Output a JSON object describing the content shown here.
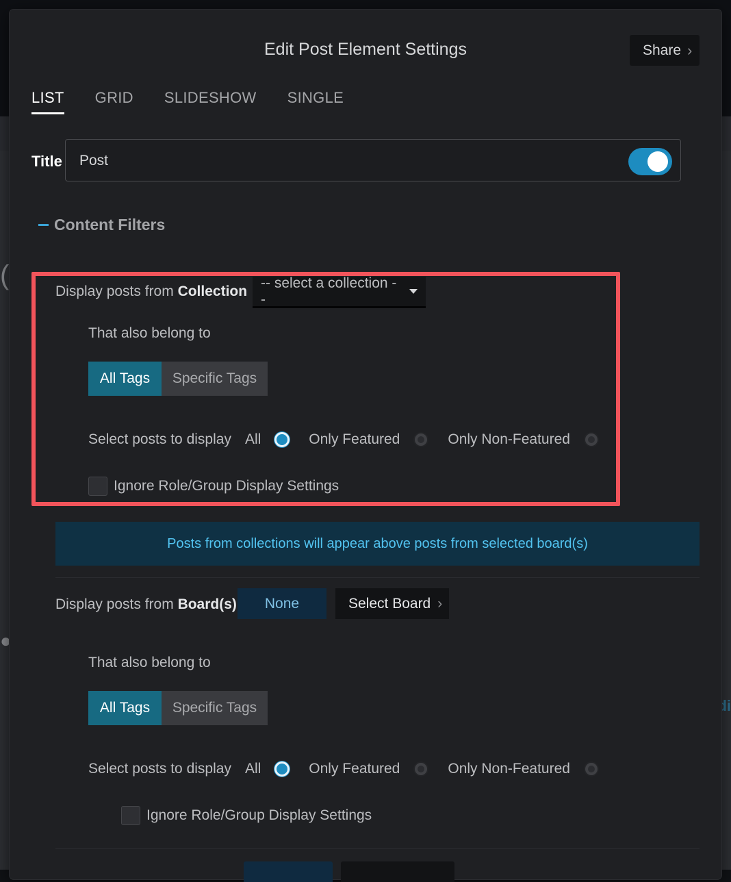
{
  "modal": {
    "title": "Edit Post Element Settings",
    "share_label": "Share"
  },
  "tabs": [
    {
      "label": "LIST",
      "active": true
    },
    {
      "label": "GRID",
      "active": false
    },
    {
      "label": "SLIDESHOW",
      "active": false
    },
    {
      "label": "SINGLE",
      "active": false
    }
  ],
  "title_field": {
    "label": "Title",
    "value": "Post",
    "toggle_on": true
  },
  "content_filters": {
    "heading": "Content Filters"
  },
  "collection": {
    "label_prefix": "Display posts from ",
    "label_strong": "Collection",
    "select_value": "-- select a collection --",
    "belong_label": "That also belong to",
    "tag_options": [
      "All Tags",
      "Specific Tags"
    ],
    "selected_tag": "All Tags",
    "display_label": "Select posts to display",
    "display_options": [
      "All",
      "Only Featured",
      "Only Non-Featured"
    ],
    "selected_display": "All",
    "ignore_label": "Ignore Role/Group Display Settings"
  },
  "info_banner": "Posts from collections will appear above posts from selected board(s)",
  "boards": {
    "label_prefix": "Display posts from ",
    "label_strong": "Board(s)",
    "none_label": "None",
    "select_label": "Select Board",
    "belong_label": "That also belong to",
    "tag_options": [
      "All Tags",
      "Specific Tags"
    ],
    "selected_tag": "All Tags",
    "display_label": "Select posts to display",
    "display_options": [
      "All",
      "Only Featured",
      "Only Non-Featured"
    ],
    "selected_display": "All",
    "ignore_label": "Ignore Role/Group Display Settings"
  },
  "colors": {
    "accent": "#1d8cc0",
    "highlight": "#f2545b",
    "banner_text": "#52c3f0",
    "segment_active": "#176a82"
  },
  "icons": {
    "share_chevron": "chevron-right-icon",
    "board_chevron": "chevron-right-icon",
    "select_caret": "caret-down-icon",
    "section_toggle": "minus-icon"
  }
}
